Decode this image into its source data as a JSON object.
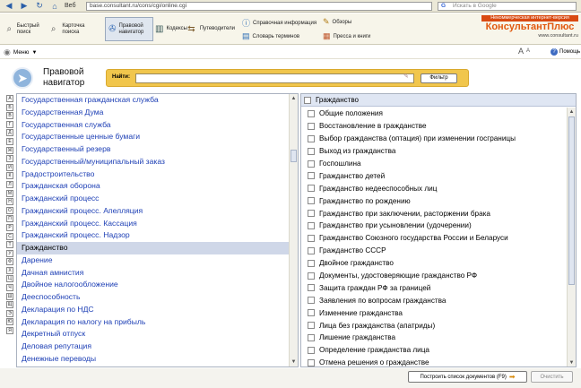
{
  "browser": {
    "tab_label": "Веб",
    "url": "base.consultant.ru/cons/cgi/online.cgi",
    "search_placeholder": "Искать в Google"
  },
  "toolbar": {
    "quick_search": "Быстрый поиск",
    "card_search": "Карточка поиска",
    "legal_navigator": "Правовой навигатор",
    "codes": "Кодексы",
    "guides": "Путеводители",
    "reference_info": "Справочная информация",
    "glossary": "Словарь терминов",
    "reviews": "Обзоры",
    "press": "Пресса и книги"
  },
  "brand": {
    "tagline": "Некоммерческая интернет-версия",
    "name": "КонсультантПлюс",
    "site": "www.consultant.ru"
  },
  "menubar": {
    "menu_label": "Меню",
    "font_larger": "A",
    "font_smaller": "A",
    "help_label": "Помощь"
  },
  "header": {
    "title_line1": "Правовой",
    "title_line2": "навигатор",
    "find_label": "Найти:",
    "find_value": "",
    "filter_button": "Фильтр"
  },
  "alphabet": [
    "А",
    "Б",
    "В",
    "Г",
    "Д",
    "Е",
    "Ж",
    "З",
    "И",
    "К",
    "Л",
    "М",
    "Н",
    "О",
    "П",
    "Р",
    "С",
    "Т",
    "У",
    "Ф",
    "Х",
    "Ц",
    "Ч",
    "Ш",
    "Щ",
    "Э",
    "Ю",
    "Я"
  ],
  "left_list": {
    "items": [
      "Государственная гражданская служба",
      "Государственная Дума",
      "Государственная служба",
      "Государственные ценные бумаги",
      "Государственный резерв",
      "Государственный/муниципальный заказ",
      "Градостроительство",
      "Гражданская оборона",
      "Гражданский процесс",
      "Гражданский процесс. Апелляция",
      "Гражданский процесс. Кассация",
      "Гражданский процесс. Надзор",
      "Гражданство",
      "Дарение",
      "Дачная амнистия",
      "Двойное налогообложение",
      "Дееспособность",
      "Декларация по НДС",
      "Декларация по налогу на прибыль",
      "Декретный отпуск",
      "Деловая репутация",
      "Денежные переводы"
    ],
    "selected_index": 12
  },
  "right_list": {
    "header": "Гражданство",
    "items": [
      "Общие положения",
      "Восстановление в гражданстве",
      "Выбор гражданства (оптация) при изменении госграницы",
      "Выход из гражданства",
      "Госпошлина",
      "Гражданство детей",
      "Гражданство недееспособных лиц",
      "Гражданство по рождению",
      "Гражданство при заключении, расторжении брака",
      "Гражданство при усыновлении (удочерении)",
      "Гражданство Союзного государства России и Беларуси",
      "Гражданство СССР",
      "Двойное гражданство",
      "Документы, удостоверяющие гражданство РФ",
      "Защита граждан РФ за границей",
      "Заявления по вопросам гражданства",
      "Изменение гражданства",
      "Лица без гражданства (апатриды)",
      "Лишение гражданства",
      "Определение гражданства лица",
      "Отмена решения о гражданстве"
    ]
  },
  "bottom": {
    "build_button": "Построить список документов (F9)",
    "clear_button": "Очистить"
  }
}
